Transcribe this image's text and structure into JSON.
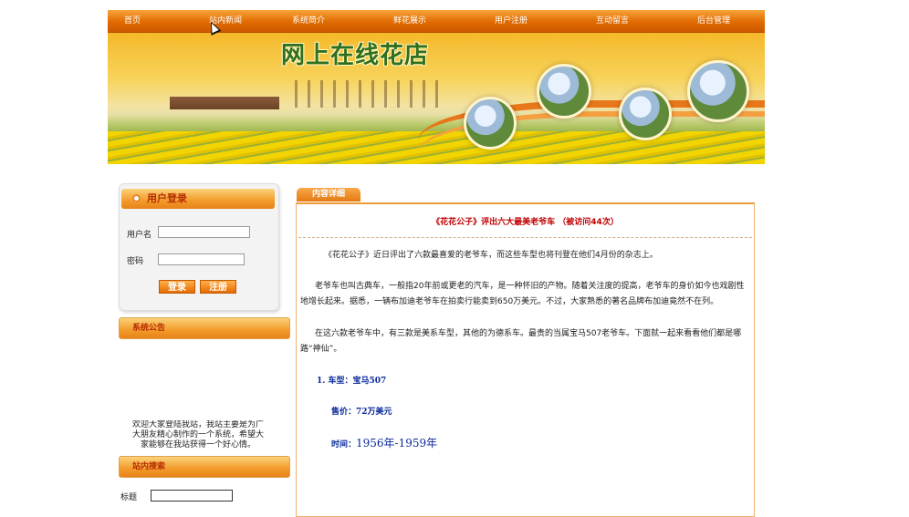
{
  "nav": {
    "items": [
      {
        "label": "首页"
      },
      {
        "label": "站内新闻"
      },
      {
        "label": "系统简介"
      },
      {
        "label": "鲜花展示"
      },
      {
        "label": "用户注册"
      },
      {
        "label": "互动留言"
      },
      {
        "label": "后台管理"
      }
    ]
  },
  "banner": {
    "title": "网上在线花店"
  },
  "login": {
    "title": "用户登录",
    "username_label": "用户名",
    "password_label": "密码",
    "login_button": "登录",
    "register_button": "注册"
  },
  "notice": {
    "title": "系统公告",
    "text": "欢迎大家登陆我站，我站主要是为广大朋友精心制作的一个系统，希望大家能够在我站获得一个好心情。"
  },
  "search": {
    "title": "站内搜索",
    "title_label": "标题"
  },
  "content": {
    "tab_label": "内容详细",
    "title": "《花花公子》评出六大最美老爷车 （被访问44次）",
    "paragraphs": [
      "《花花公子》近日评出了六款最喜爱的老爷车，而这些车型也将刊登在他们4月份的杂志上。",
      "老爷车也叫古典车，一般指20年前或更老的汽车，是一种怀旧的产物。随着关注度的提高，老爷车的身价如今也戏剧性地增长起来。据悉，一辆布加迪老爷车在拍卖行能卖到650万美元。不过，大家熟悉的著名品牌布加迪竟然不在列。",
      "在这六款老爷车中，有三款是美系车型，其他的为德系车。最贵的当属宝马507老爷车。下面就一起来看看他们都是哪路“神仙”。"
    ],
    "item_model": "1.  车型：宝马507",
    "item_price": "售价：72万美元",
    "item_time_prefix": "时间：",
    "item_time_value": "1956年-1959年"
  }
}
